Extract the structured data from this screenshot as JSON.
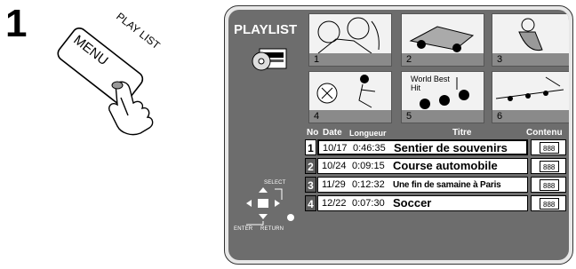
{
  "step_number": "1",
  "remote": {
    "button_label": "MENU",
    "arc_label": "PLAY LIST"
  },
  "screen": {
    "title": "PLAYLIST",
    "thumbnails": [
      {
        "num": "1",
        "caption": ""
      },
      {
        "num": "2",
        "caption": ""
      },
      {
        "num": "3",
        "caption": ""
      },
      {
        "num": "4",
        "caption": ""
      },
      {
        "num": "5",
        "caption": "World Best Hit"
      },
      {
        "num": "6",
        "caption": ""
      }
    ],
    "columns": {
      "no": "No",
      "date": "Date",
      "length": "Longueur",
      "title": "Titre",
      "content": "Contenu"
    },
    "rows": [
      {
        "no": "1",
        "date": "10/17",
        "length": "0:46:35",
        "title": "Sentier de souvenirs"
      },
      {
        "no": "2",
        "date": "10/24",
        "length": "0:09:15",
        "title": "Course automobile"
      },
      {
        "no": "3",
        "date": "11/29",
        "length": "0:12:32",
        "title": "Une fin de samaine à Paris"
      },
      {
        "no": "4",
        "date": "12/22",
        "length": "0:07:30",
        "title": "Soccer"
      }
    ],
    "nav": {
      "select": "SELECT",
      "enter": "ENTER",
      "return": "RETURN"
    }
  }
}
